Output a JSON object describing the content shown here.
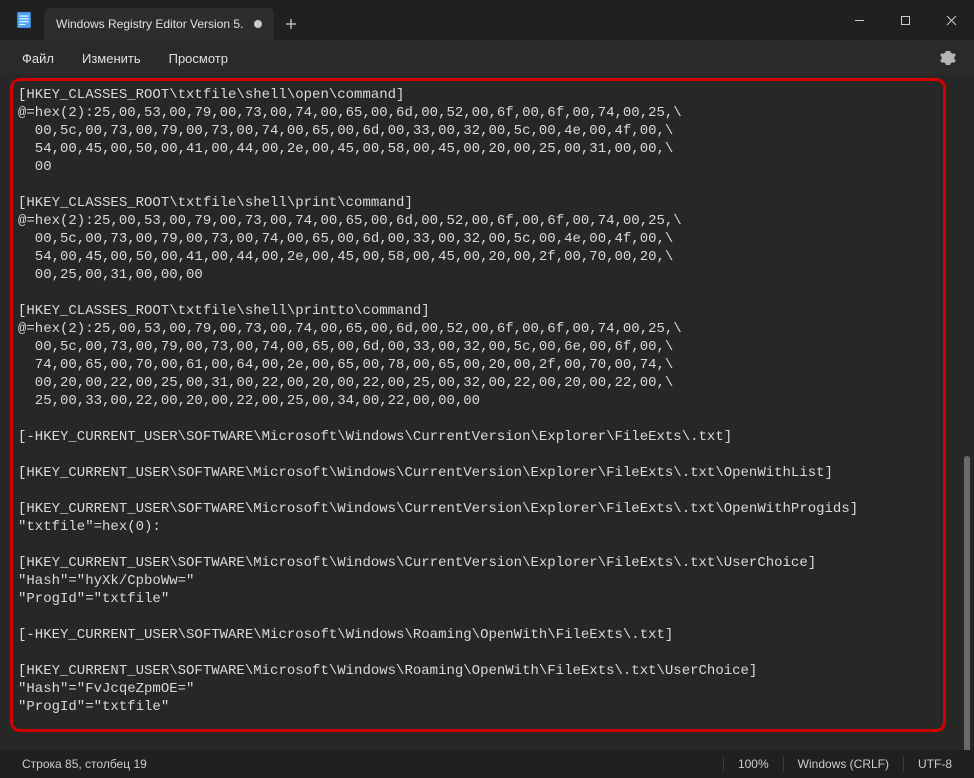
{
  "titlebar": {
    "tab_title": "Windows Registry Editor Version 5."
  },
  "menubar": {
    "file": "Файл",
    "edit": "Изменить",
    "view": "Просмотр"
  },
  "editor": {
    "content": "[HKEY_CLASSES_ROOT\\txtfile\\shell\\open\\command]\n@=hex(2):25,00,53,00,79,00,73,00,74,00,65,00,6d,00,52,00,6f,00,6f,00,74,00,25,\\\n  00,5c,00,73,00,79,00,73,00,74,00,65,00,6d,00,33,00,32,00,5c,00,4e,00,4f,00,\\\n  54,00,45,00,50,00,41,00,44,00,2e,00,45,00,58,00,45,00,20,00,25,00,31,00,00,\\\n  00\n\n[HKEY_CLASSES_ROOT\\txtfile\\shell\\print\\command]\n@=hex(2):25,00,53,00,79,00,73,00,74,00,65,00,6d,00,52,00,6f,00,6f,00,74,00,25,\\\n  00,5c,00,73,00,79,00,73,00,74,00,65,00,6d,00,33,00,32,00,5c,00,4e,00,4f,00,\\\n  54,00,45,00,50,00,41,00,44,00,2e,00,45,00,58,00,45,00,20,00,2f,00,70,00,20,\\\n  00,25,00,31,00,00,00\n\n[HKEY_CLASSES_ROOT\\txtfile\\shell\\printto\\command]\n@=hex(2):25,00,53,00,79,00,73,00,74,00,65,00,6d,00,52,00,6f,00,6f,00,74,00,25,\\\n  00,5c,00,73,00,79,00,73,00,74,00,65,00,6d,00,33,00,32,00,5c,00,6e,00,6f,00,\\\n  74,00,65,00,70,00,61,00,64,00,2e,00,65,00,78,00,65,00,20,00,2f,00,70,00,74,\\\n  00,20,00,22,00,25,00,31,00,22,00,20,00,22,00,25,00,32,00,22,00,20,00,22,00,\\\n  25,00,33,00,22,00,20,00,22,00,25,00,34,00,22,00,00,00\n\n[-HKEY_CURRENT_USER\\SOFTWARE\\Microsoft\\Windows\\CurrentVersion\\Explorer\\FileExts\\.txt]\n\n[HKEY_CURRENT_USER\\SOFTWARE\\Microsoft\\Windows\\CurrentVersion\\Explorer\\FileExts\\.txt\\OpenWithList]\n\n[HKEY_CURRENT_USER\\SOFTWARE\\Microsoft\\Windows\\CurrentVersion\\Explorer\\FileExts\\.txt\\OpenWithProgids]\n\"txtfile\"=hex(0):\n\n[HKEY_CURRENT_USER\\SOFTWARE\\Microsoft\\Windows\\CurrentVersion\\Explorer\\FileExts\\.txt\\UserChoice]\n\"Hash\"=\"hyXk/CpboWw=\"\n\"ProgId\"=\"txtfile\"\n\n[-HKEY_CURRENT_USER\\SOFTWARE\\Microsoft\\Windows\\Roaming\\OpenWith\\FileExts\\.txt]\n\n[HKEY_CURRENT_USER\\SOFTWARE\\Microsoft\\Windows\\Roaming\\OpenWith\\FileExts\\.txt\\UserChoice]\n\"Hash\"=\"FvJcqeZpmOE=\"\n\"ProgId\"=\"txtfile\""
  },
  "statusbar": {
    "position": "Строка 85, столбец 19",
    "zoom": "100%",
    "line_ending": "Windows (CRLF)",
    "encoding": "UTF-8"
  }
}
